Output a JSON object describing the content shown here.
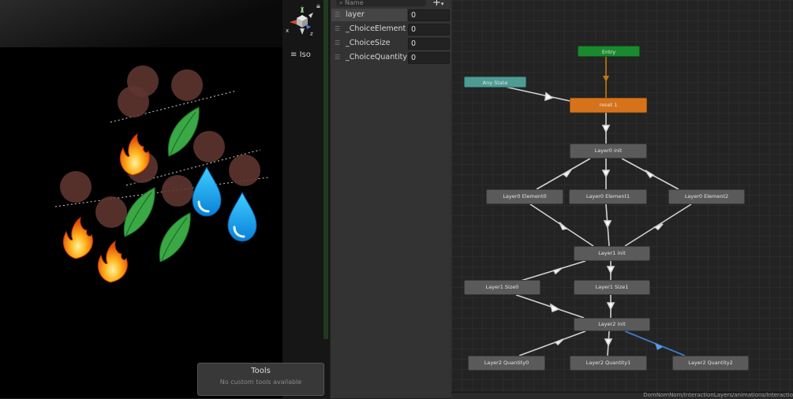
{
  "scene": {
    "gizmo": {
      "axis_y": "y",
      "axis_x": "x",
      "axis_z": "z"
    },
    "projection_label": "Iso",
    "tools_overlay": {
      "title": "Tools",
      "message": "No custom tools available"
    }
  },
  "parameters": {
    "search_placeholder": "Name",
    "add_button": "+",
    "items": [
      {
        "name": "layer",
        "value": "0"
      },
      {
        "name": "_ChoiceElement",
        "value": "0"
      },
      {
        "name": "_ChoiceSize",
        "value": "0"
      },
      {
        "name": "_ChoiceQuantity",
        "value": "0"
      }
    ]
  },
  "graph": {
    "states": {
      "entry": "Entry",
      "any_state": "Any State",
      "reset": "reset 1",
      "layer0_init": "Layer0 init",
      "layer0_element0": "Layer0 Element0",
      "layer0_element1": "Layer0 Element1",
      "layer0_element2": "Layer0 Element2",
      "layer1_init": "Layer1 init",
      "layer1_size0": "Layer1 Size0",
      "layer1_size1": "Layer1 Size1",
      "layer2_init": "Layer2 init",
      "layer2_quantity0": "Layer2 Quantity0",
      "layer2_quantity1": "Layer2 Quantity1",
      "layer2_quantity2": "Layer2 Quantity2"
    },
    "colors": {
      "entry": "#1a8a2e",
      "any_state": "#4e9b93",
      "default_state": "#d6731a",
      "state": "#5a5a5a",
      "selected_transition": "#3d7ac2",
      "entry_transition": "#c07a10"
    },
    "footer_path": "DomNomNom/InteractionLayers/animations/Interactio"
  }
}
